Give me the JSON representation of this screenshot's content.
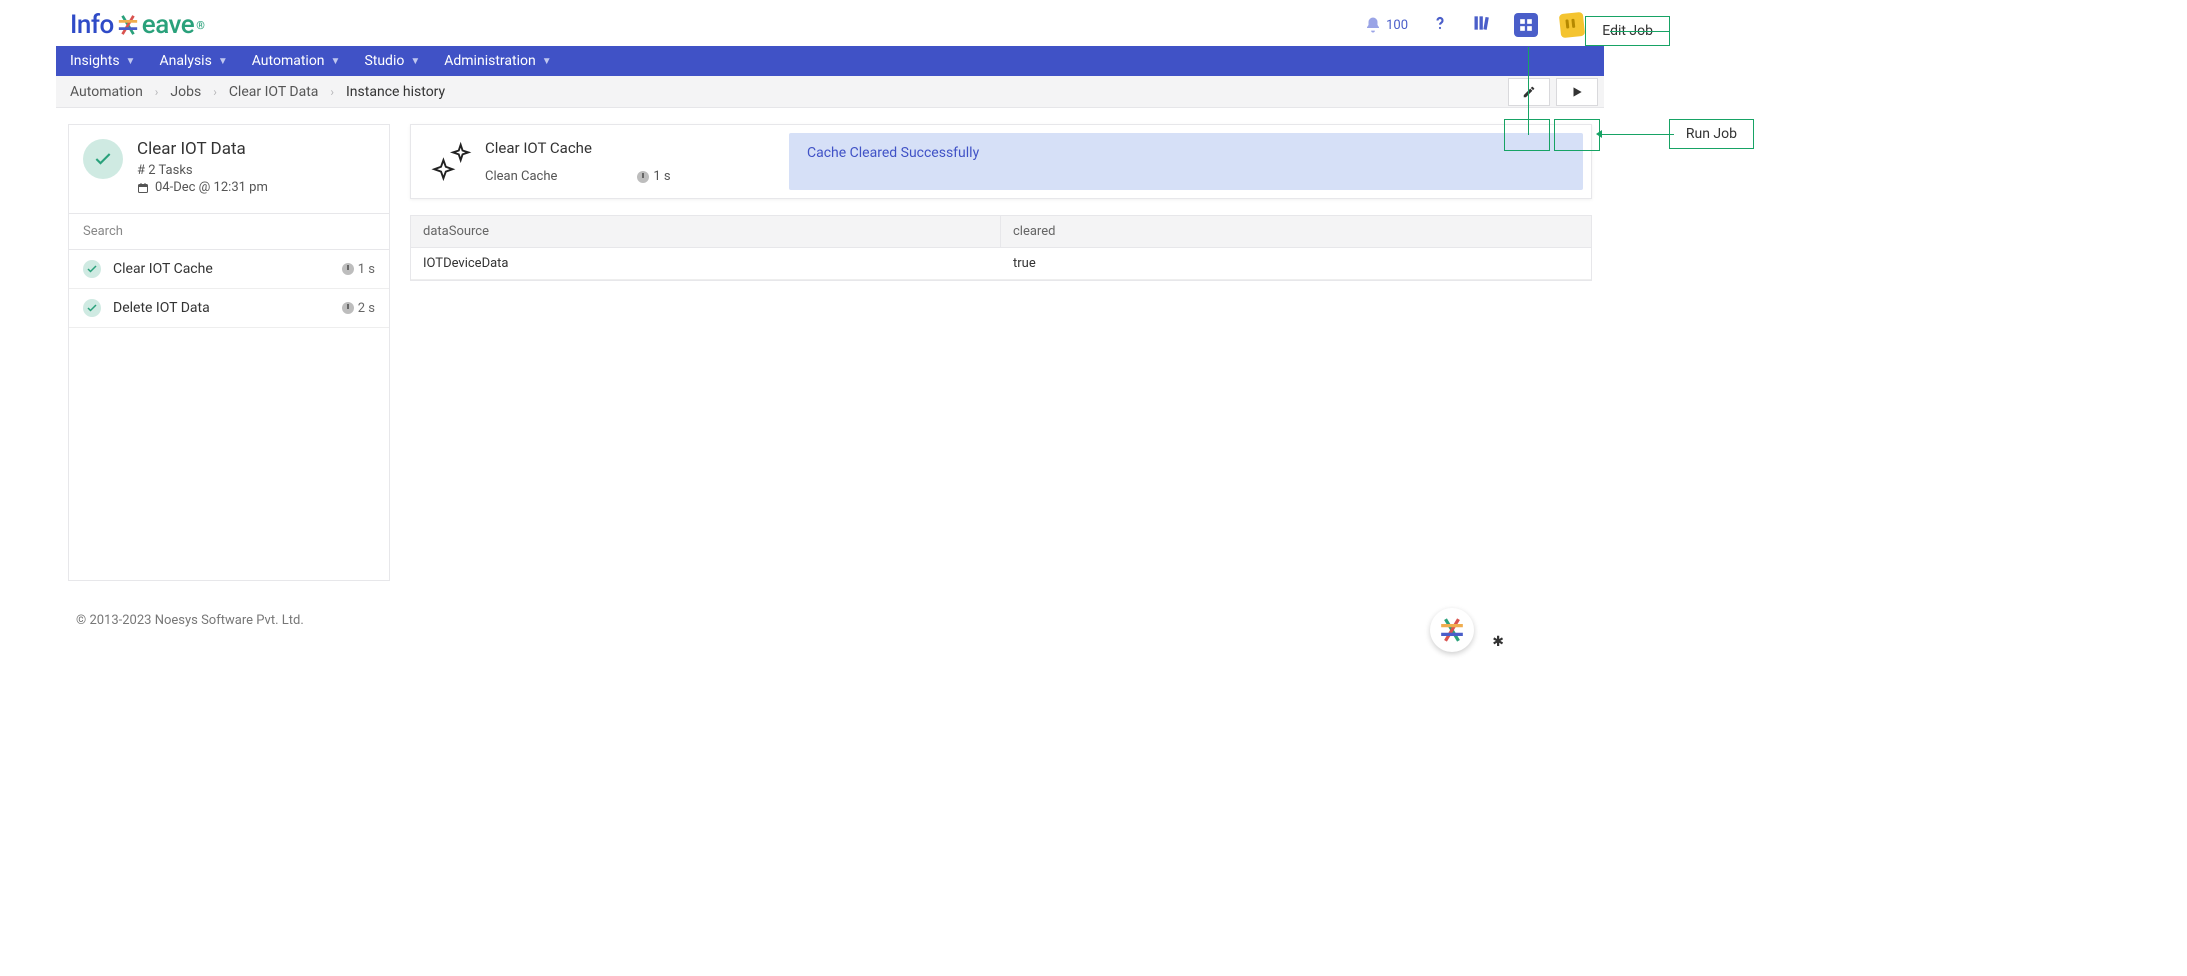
{
  "logo": {
    "prefix": "Info",
    "suffix": "eave",
    "reg": "®"
  },
  "notifications": {
    "count": "100"
  },
  "nav": {
    "items": [
      {
        "label": "Insights"
      },
      {
        "label": "Analysis"
      },
      {
        "label": "Automation"
      },
      {
        "label": "Studio"
      },
      {
        "label": "Administration"
      }
    ]
  },
  "breadcrumb": {
    "items": [
      {
        "label": "Automation"
      },
      {
        "label": "Jobs"
      },
      {
        "label": "Clear IOT Data"
      },
      {
        "label": "Instance history"
      }
    ]
  },
  "annotations": {
    "edit": "Edit Job",
    "run": "Run Job"
  },
  "job": {
    "title": "Clear IOT Data",
    "tasks_label": "# 2 Tasks",
    "timestamp": "04-Dec @ 12:31 pm"
  },
  "search": {
    "placeholder": "Search"
  },
  "tasks": [
    {
      "name": "Clear IOT Cache",
      "duration": "1 s"
    },
    {
      "name": "Delete IOT Data",
      "duration": "2 s"
    }
  ],
  "detail": {
    "title": "Clear IOT Cache",
    "subtitle": "Clean Cache",
    "duration": "1 s",
    "status": "Cache Cleared Successfully"
  },
  "table": {
    "headers": {
      "dataSource": "dataSource",
      "cleared": "cleared"
    },
    "rows": [
      {
        "dataSource": "IOTDeviceData",
        "cleared": "true"
      }
    ]
  },
  "footer": {
    "copyright": "© 2013-2023 Noesys Software Pvt. Ltd."
  }
}
